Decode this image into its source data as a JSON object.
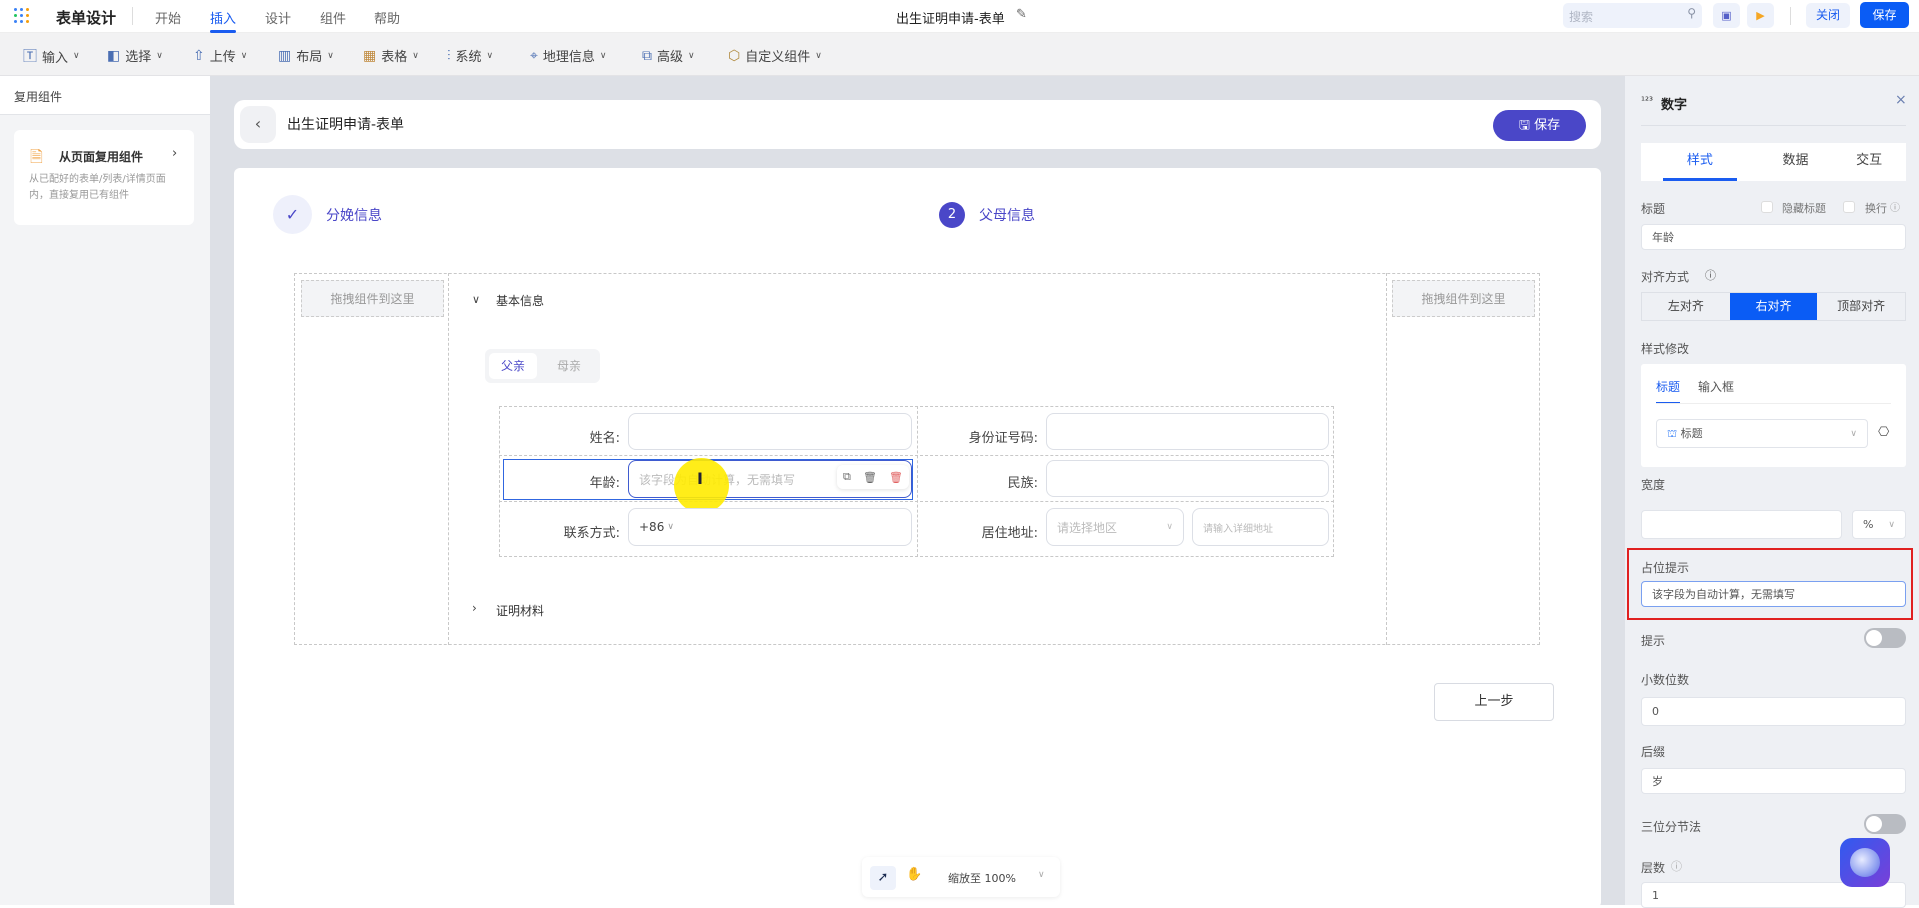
{
  "header": {
    "app_title": "表单设计",
    "menus": [
      "开始",
      "插入",
      "设计",
      "组件",
      "帮助"
    ],
    "active_menu": "插入",
    "doc_title": "出生证明申请-表单",
    "search_placeholder": "搜索",
    "close_label": "关闭",
    "save_label": "保存"
  },
  "toolbar": [
    "输入",
    "选择",
    "上传",
    "布局",
    "表格",
    "系统",
    "地理信息",
    "高级",
    "自定义组件"
  ],
  "left": {
    "title": "复用组件",
    "card_title": "从页面复用组件",
    "card_desc": "从已配好的表单/列表/详情页面内，直接复用已有组件"
  },
  "canvas": {
    "page_title": "出生证明申请-表单",
    "save_label": "保存",
    "steps": [
      {
        "label": "分娩信息",
        "state": "done"
      },
      {
        "index": "2",
        "label": "父母信息",
        "state": "active"
      }
    ],
    "drop_hint": "拖拽组件到这里",
    "section1": "基本信息",
    "section2": "证明材料",
    "tabs": [
      "父亲",
      "母亲"
    ],
    "fields": {
      "name": "姓名:",
      "id": "身份证号码:",
      "age": "年龄:",
      "age_placeholder": "该字段为自动计算，无需填写",
      "nation": "民族:",
      "phone": "联系方式:",
      "phone_prefix": "+86",
      "address": "居住地址:",
      "region_placeholder": "请选择地区",
      "detail_placeholder": "请输入详细地址"
    },
    "prev_label": "上一步",
    "zoom_label": "缩放至 100%"
  },
  "panel": {
    "title": "数字",
    "tabs": [
      "样式",
      "数据",
      "交互"
    ],
    "title_label": "标题",
    "hide_title": "隐藏标题",
    "wrap": "换行",
    "title_value": "年龄",
    "align_label": "对齐方式",
    "align_options": [
      "左对齐",
      "右对齐",
      "顶部对齐"
    ],
    "align_selected": "右对齐",
    "style_label": "样式修改",
    "style_tabs": [
      "标题",
      "输入框"
    ],
    "style_select": "标题",
    "width_label": "宽度",
    "width_unit": "%",
    "placeholder_label": "占位提示",
    "placeholder_value": "该字段为自动计算，无需填写",
    "hint_label": "提示",
    "hint_on": false,
    "decimals_label": "小数位数",
    "decimals_value": "0",
    "suffix_label": "后缀",
    "suffix_value": "岁",
    "thousands_label": "三位分节法",
    "thousands_on": false,
    "layers_label": "层数",
    "layers_value": "1"
  },
  "colors": {
    "primary": "#0a5cf5",
    "indigo": "#4a47c8",
    "highlight": "#e02020"
  }
}
